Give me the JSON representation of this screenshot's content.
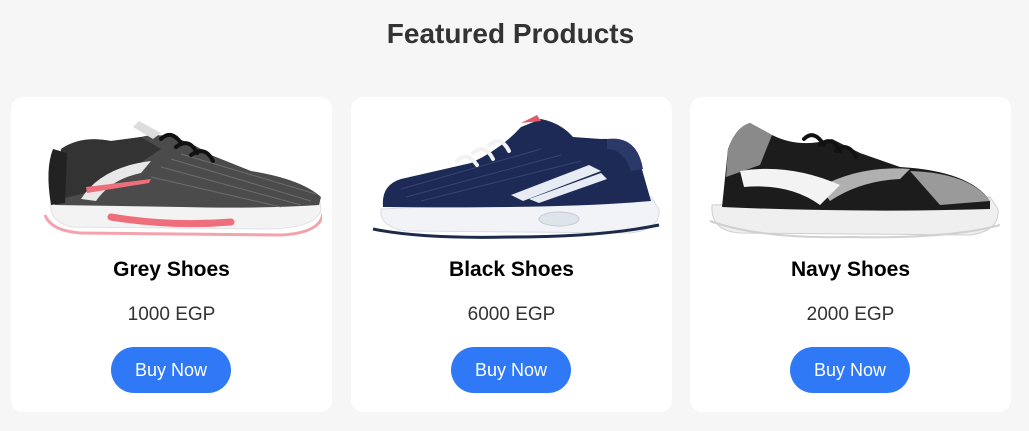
{
  "page": {
    "title": "Featured Products"
  },
  "products": [
    {
      "name": "Grey Shoes",
      "price": "1000 EGP",
      "button_label": "Buy Now",
      "image_icon": "grey-sneaker-icon"
    },
    {
      "name": "Black Shoes",
      "price": "6000 EGP",
      "button_label": "Buy Now",
      "image_icon": "navy-sneaker-icon"
    },
    {
      "name": "Navy Shoes",
      "price": "2000 EGP",
      "button_label": "Buy Now",
      "image_icon": "black-grey-sneaker-icon"
    }
  ],
  "colors": {
    "background": "#f6f6f6",
    "card": "#ffffff",
    "button": "#3079f6",
    "button_text": "#ffffff"
  }
}
